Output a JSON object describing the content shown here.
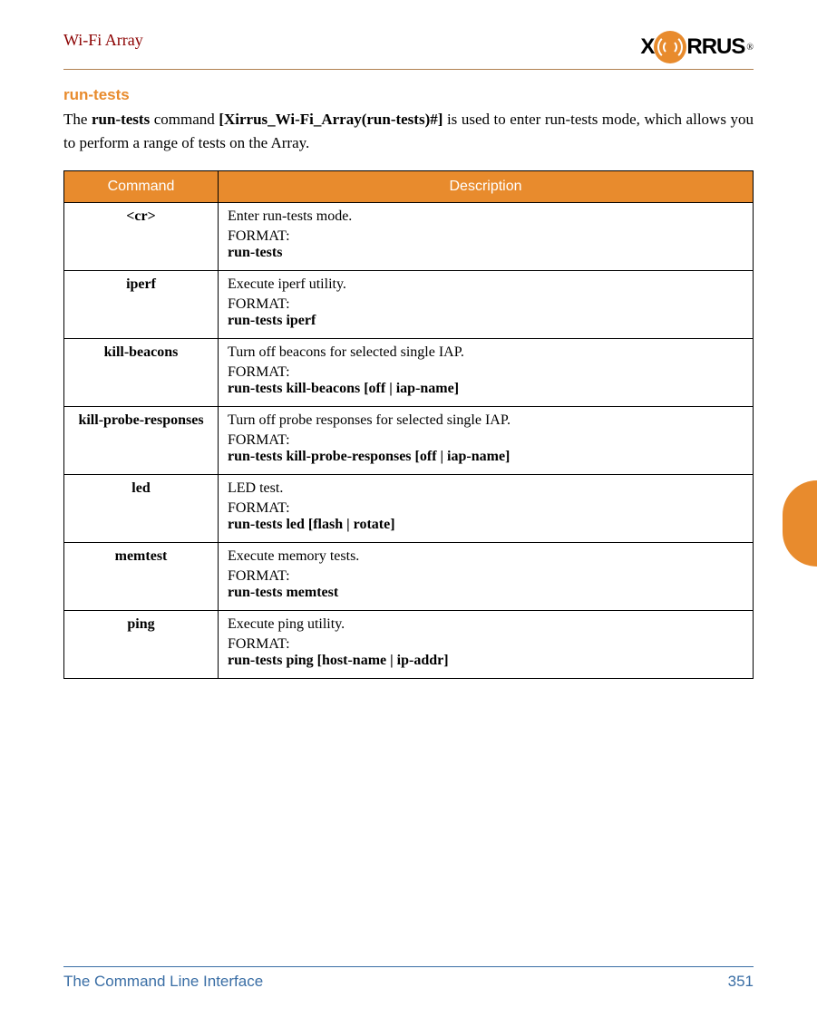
{
  "header": {
    "title": "Wi-Fi Array",
    "logo_left": "X",
    "logo_right": "RRUS",
    "logo_reg": "®"
  },
  "section": {
    "title": "run-tests",
    "intro_1": "The ",
    "intro_cmd": "run-tests",
    "intro_2": " command ",
    "intro_prompt": "[Xirrus_Wi-Fi_Array(run-tests)#]",
    "intro_3": " is used to enter run-tests mode, which allows you to perform a range of tests on the Array."
  },
  "table": {
    "headers": {
      "command": "Command",
      "description": "Description"
    },
    "format_label": "FORMAT:",
    "rows": [
      {
        "cmd": "<cr>",
        "desc": "Enter run-tests mode.",
        "format": "run-tests"
      },
      {
        "cmd": "iperf",
        "desc": " Execute iperf utility.",
        "format": "run-tests iperf"
      },
      {
        "cmd": "kill-beacons",
        "desc": "Turn off beacons for selected single IAP.",
        "format": "run-tests kill-beacons [off | iap-name]"
      },
      {
        "cmd": "kill-probe-responses",
        "desc": " Turn off probe responses for selected single IAP.",
        "format": "run-tests kill-probe-responses [off | iap-name]"
      },
      {
        "cmd": "led",
        "desc": "LED test.",
        "format": "run-tests led [flash | rotate]"
      },
      {
        "cmd": "memtest",
        "desc": " Execute memory tests.",
        "format": "run-tests memtest"
      },
      {
        "cmd": "ping",
        "desc": " Execute ping utility.",
        "format": "run-tests ping [host-name | ip-addr]"
      }
    ]
  },
  "footer": {
    "left": "The Command Line Interface",
    "right": "351"
  }
}
